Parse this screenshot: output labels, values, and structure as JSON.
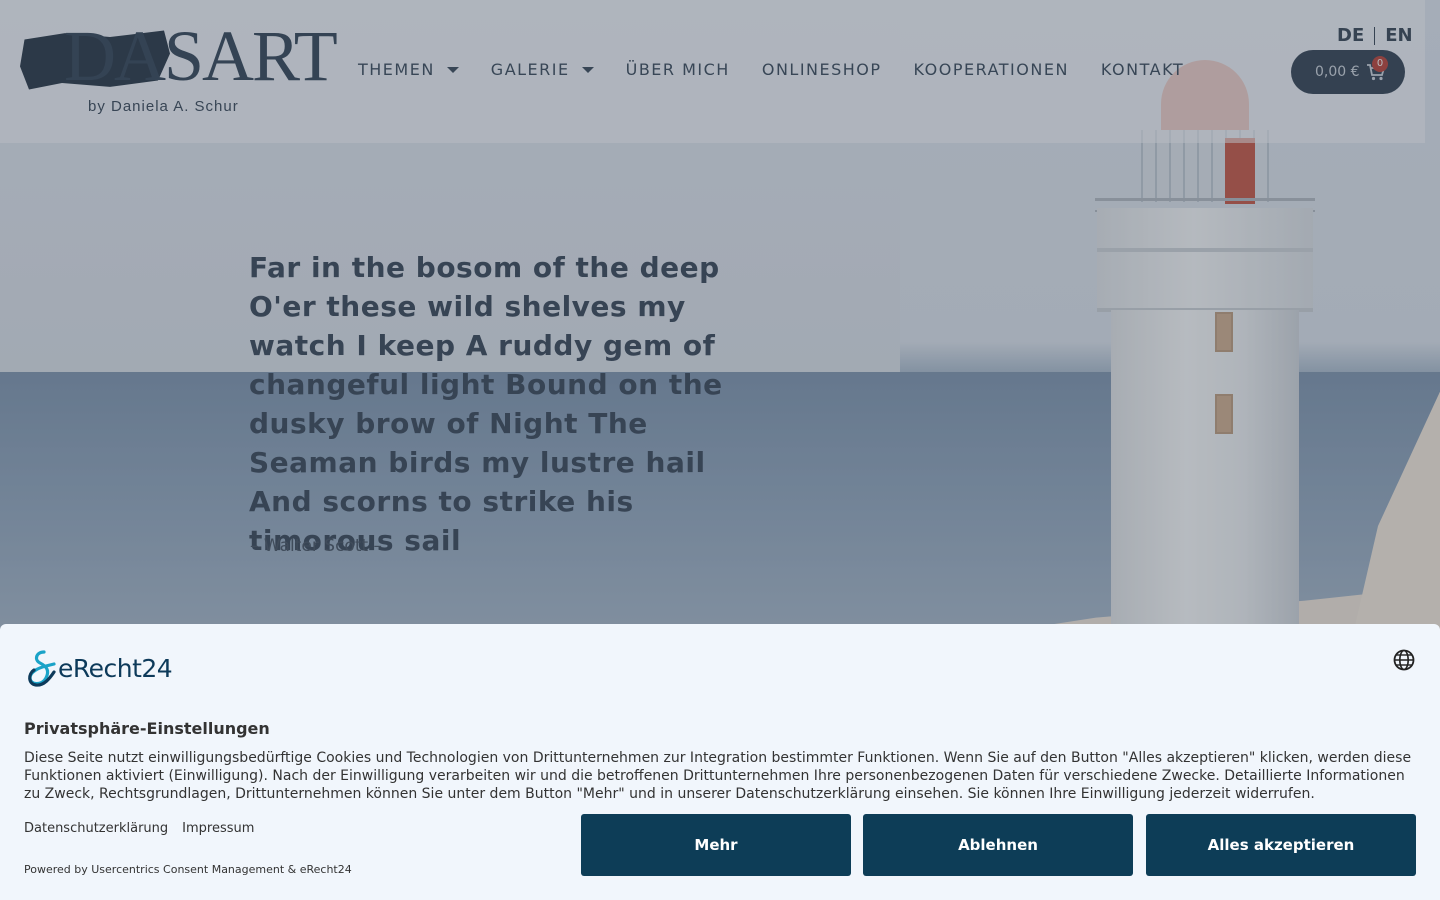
{
  "header": {
    "logo_word": "DASART",
    "logo_tagline": "by Daniela A. Schur",
    "nav": [
      {
        "label": "THEMEN",
        "has_dropdown": true
      },
      {
        "label": "GALERIE",
        "has_dropdown": true
      },
      {
        "label": "ÜBER MICH",
        "has_dropdown": false
      },
      {
        "label": "ONLINESHOP",
        "has_dropdown": false
      },
      {
        "label": "KOOPERATIONEN",
        "has_dropdown": false
      },
      {
        "label": "KONTAKT",
        "has_dropdown": false
      }
    ],
    "lang": {
      "de": "DE",
      "en": "EN"
    },
    "cart": {
      "amount": "0,00 €",
      "count": "0",
      "icon": "cart-icon"
    }
  },
  "hero": {
    "quote": "Far in the bosom of the deep O'er these wild shelves my watch I keep A ruddy gem of changeful light Bound on the dusky brow of Night The Seaman birds my lustre hail And scorns to strike his timorous sail",
    "author": "– Walter Scott –"
  },
  "consent": {
    "brand": "eRecht24",
    "title": "Privatsphäre-Einstellungen",
    "text": "Diese Seite nutzt einwilligungsbedürftige Cookies und Technologien von Drittunternehmen zur Integration bestimmter Funktionen. Wenn Sie auf den Button \"Alles akzeptieren\" klicken, werden diese Funktionen aktiviert (Einwilligung). Nach der Einwilligung verarbeiten wir und die betroffenen Drittunternehmen Ihre personenbezogenen Daten für verschiedene Zwecke. Detaillierte Informationen zu Zweck, Rechtsgrundlagen, Drittunternehmen können Sie unter dem Button \"Mehr\" und in unserer Datenschutzerklärung einsehen. Sie können Ihre Einwilligung jederzeit widerrufen.",
    "links": {
      "privacy": "Datenschutzerklärung",
      "imprint": "Impressum"
    },
    "powered": "Powered by Usercentrics Consent Management & eRecht24",
    "buttons": {
      "more": "Mehr",
      "deny": "Ablehnen",
      "accept": "Alles akzeptieren"
    },
    "colors": {
      "button_bg": "#0d3d57",
      "banner_bg": "#f1f6fc",
      "brand": "#0d3a5a",
      "brand_accent": "#1aa3c8"
    }
  }
}
